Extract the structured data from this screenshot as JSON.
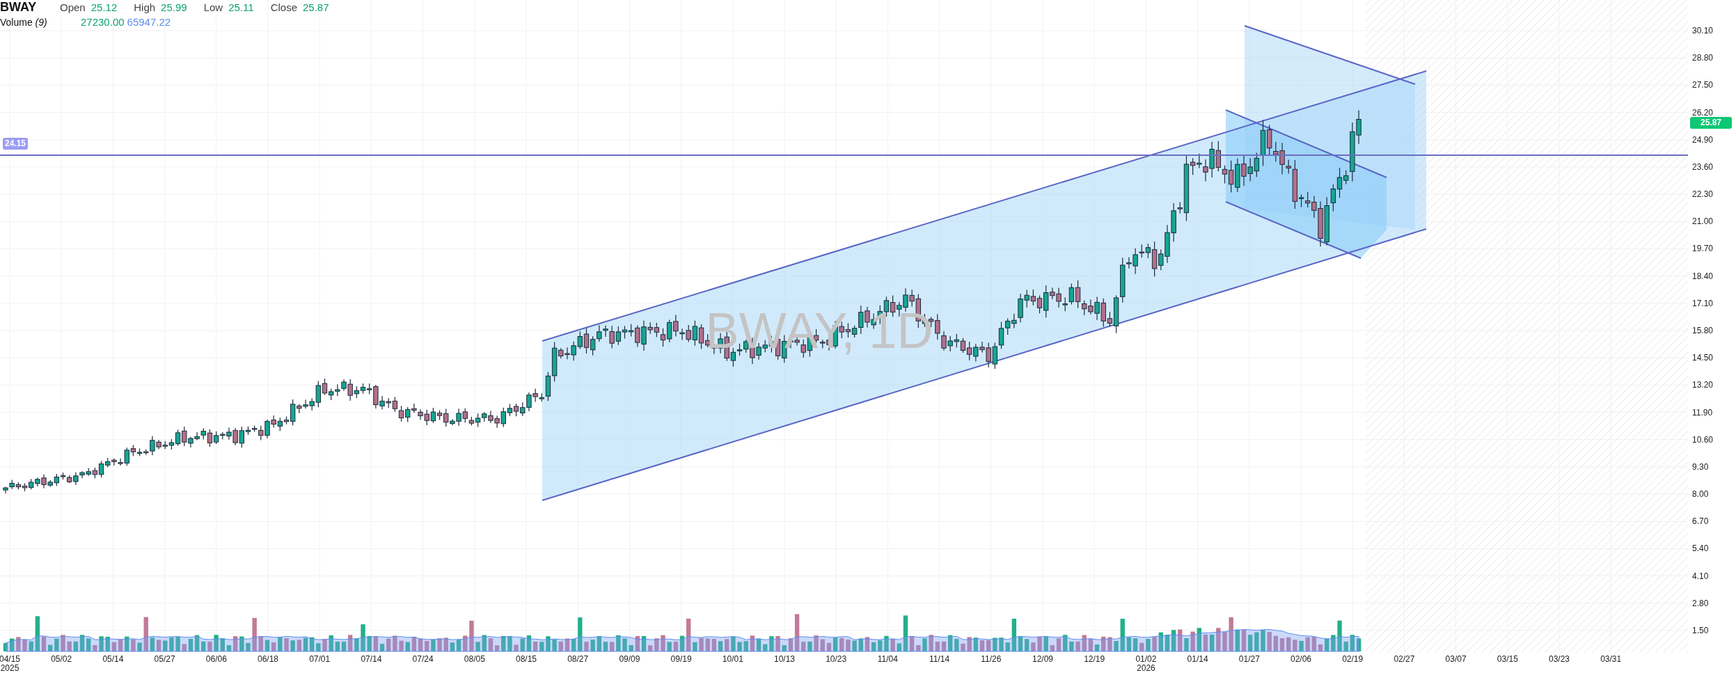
{
  "symbol": "BWAY",
  "ohlc": [
    {
      "label": "Open",
      "value": "25.12"
    },
    {
      "label": "High",
      "value": "25.99"
    },
    {
      "label": "Low",
      "value": "25.11"
    },
    {
      "label": "Close",
      "value": "25.87"
    }
  ],
  "volume": {
    "label": "Volume *(9)*",
    "values": [
      {
        "kind": "volume",
        "text": "27230.00"
      },
      {
        "kind": "average",
        "text": "65947.22"
      }
    ]
  },
  "watermark": "BWAY, 1D",
  "horizontal_line": {
    "label": "24.15"
  },
  "current_price": "25.87",
  "price_axis": [
    "30.10",
    "28.80",
    "27.50",
    "26.20",
    "24.90",
    "23.60",
    "22.30",
    "21.00",
    "19.70",
    "18.40",
    "17.10",
    "15.80",
    "14.50",
    "13.20",
    "11.90",
    "10.60",
    "9.30",
    "8.00",
    "6.70",
    "5.40",
    "4.10",
    "2.80",
    "1.50"
  ],
  "date_axis": [
    {
      "label": "04/15",
      "year": "2025"
    },
    {
      "label": "05/02"
    },
    {
      "label": "05/14"
    },
    {
      "label": "05/27"
    },
    {
      "label": "06/06"
    },
    {
      "label": "06/18"
    },
    {
      "label": "07/01"
    },
    {
      "label": "07/14"
    },
    {
      "label": "07/24"
    },
    {
      "label": "08/05"
    },
    {
      "label": "08/15"
    },
    {
      "label": "08/27"
    },
    {
      "label": "09/09"
    },
    {
      "label": "09/19"
    },
    {
      "label": "10/01"
    },
    {
      "label": "10/13"
    },
    {
      "label": "10/23"
    },
    {
      "label": "11/04"
    },
    {
      "label": "11/14"
    },
    {
      "label": "11/26"
    },
    {
      "label": "12/09"
    },
    {
      "label": "12/19"
    },
    {
      "label": "01/02",
      "year": "2026"
    },
    {
      "label": "01/14"
    },
    {
      "label": "01/27"
    },
    {
      "label": "02/06"
    },
    {
      "label": "02/19"
    },
    {
      "label": "02/27"
    },
    {
      "label": "03/07"
    },
    {
      "label": "03/15"
    },
    {
      "label": "03/23"
    },
    {
      "label": "03/31"
    }
  ]
}
